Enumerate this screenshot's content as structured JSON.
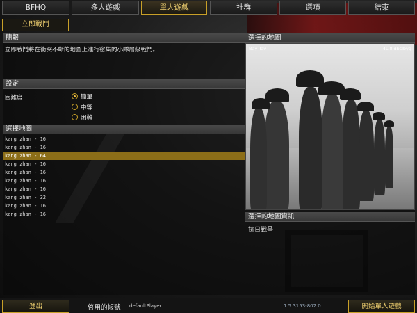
{
  "nav": {
    "items": [
      "BFHQ",
      "多人遊戲",
      "單人遊戲",
      "社群",
      "選項",
      "結束"
    ],
    "active_index": 2
  },
  "subtab": {
    "label": "立即戰鬥"
  },
  "brief": {
    "heading": "簡報",
    "text": "立即戰鬥將在衝突不斷的地圖上進行密集的小隊層級戰鬥。"
  },
  "settings": {
    "heading": "設定",
    "difficulty_label": "困難度",
    "options": [
      "簡單",
      "中等",
      "困難"
    ],
    "selected_index": 0
  },
  "map_select": {
    "heading": "選擇地圖",
    "items": [
      "kang zhan - 16",
      "kang zhan - 16",
      "kang zhan - 64",
      "kang zhan - 16",
      "kang zhan - 16",
      "kang zhan - 16",
      "kang zhan - 16",
      "kang zhan - 32",
      "kang zhan - 16",
      "kang zhan - 16"
    ],
    "selected_index": 2
  },
  "preview": {
    "heading": "選擇的地圖",
    "overlay_left": "Bay Tav",
    "overlay_right": "4L 8ldbslbyg"
  },
  "map_info": {
    "heading": "選擇的地圖資訊",
    "text": "抗日戰爭"
  },
  "bottom": {
    "logout_label": "登出",
    "account_label": "啓用的帳號",
    "account_name": "defaultPlayer",
    "version": "1.5.3153-802.0",
    "start_label": "開始單人遊戲"
  },
  "colors": {
    "accent": "#c8a028",
    "selection": "#8c6e18"
  }
}
